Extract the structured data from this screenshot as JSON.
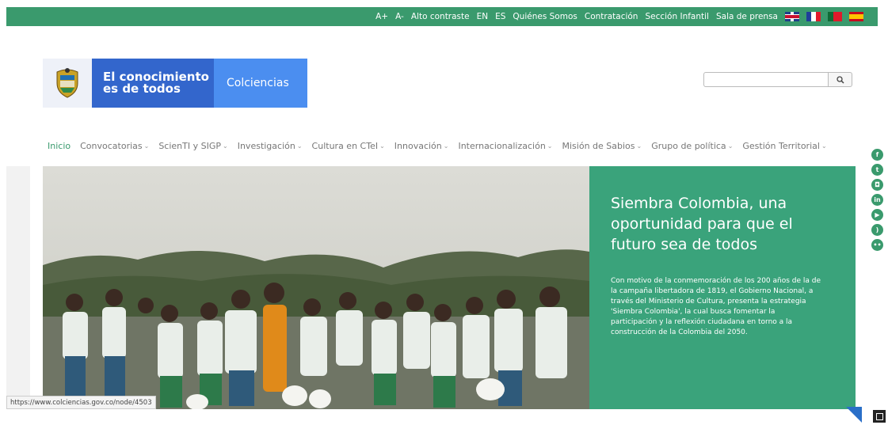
{
  "topbar": {
    "items": [
      "A+",
      "A-",
      "Alto contraste",
      "EN",
      "ES",
      "Quiénes Somos",
      "Contratación",
      "Sección Infantil",
      "Sala de prensa"
    ],
    "flags": [
      "uk-flag",
      "france-flag",
      "portugal-flag",
      "spain-flag"
    ]
  },
  "logo": {
    "line1": "El conocimiento",
    "line2": "es de todos",
    "brand": "Colciencias"
  },
  "search": {
    "placeholder": ""
  },
  "nav": {
    "items": [
      {
        "label": "Inicio"
      },
      {
        "label": "Convocatorias"
      },
      {
        "label": "ScienTI y SIGP"
      },
      {
        "label": "Investigación"
      },
      {
        "label": "Cultura en CTeI"
      },
      {
        "label": "Innovación"
      },
      {
        "label": "Internacionalización"
      },
      {
        "label": "Misión de Sabios"
      },
      {
        "label": "Grupo de política"
      },
      {
        "label": "Gestión Territorial"
      }
    ]
  },
  "hero": {
    "title": "Siembra Colombia, una oportunidad para que el futuro sea de todos",
    "description": "Con motivo de la conmemoración de los 200 años de la de la campaña libertadora de 1819, el Gobierno Nacional, a través del Ministerio de Cultura, presenta la estrategia 'Siembra Colombia', la cual busca fomentar la participación y la reflexión ciudadana en torno a la construcción de la Colombia del 2050."
  },
  "social": [
    "facebook-icon",
    "twitter-icon",
    "instagram-icon",
    "linkedin-icon",
    "youtube-icon",
    "rss-icon",
    "flickr-icon"
  ],
  "statusbar": {
    "url": "https://www.colciencias.gov.co/node/4503"
  },
  "colors": {
    "green": "#3a9a6d",
    "panel": "#3aa37b",
    "blue": "#3366cc",
    "lightblue": "#4b8ef0"
  }
}
